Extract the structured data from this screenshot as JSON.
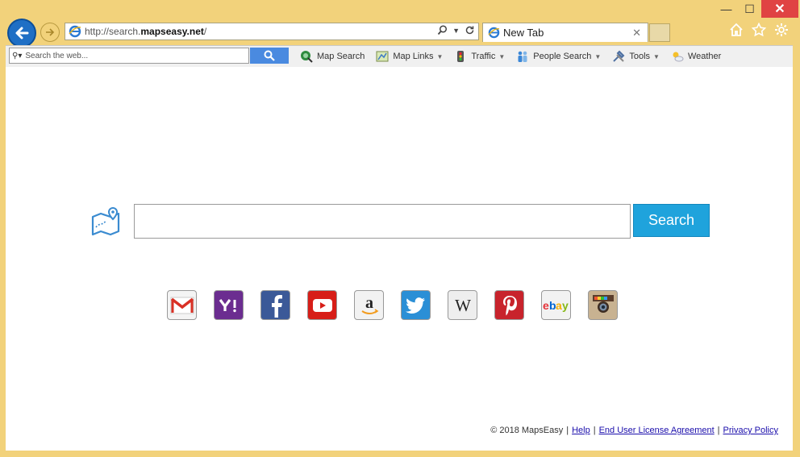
{
  "address_bar": {
    "url_prefix": "http://search.",
    "url_host": "mapseasy.net",
    "url_suffix": "/"
  },
  "tab": {
    "label": "New Tab"
  },
  "toolbar": {
    "search_placeholder": "Search the web...",
    "items": [
      {
        "label": "Map Search",
        "dropdown": false
      },
      {
        "label": "Map Links",
        "dropdown": true
      },
      {
        "label": "Traffic",
        "dropdown": true
      },
      {
        "label": "People Search",
        "dropdown": true
      },
      {
        "label": "Tools",
        "dropdown": true
      },
      {
        "label": "Weather",
        "dropdown": false
      }
    ]
  },
  "main": {
    "search_button": "Search"
  },
  "socials": [
    "gmail-icon",
    "yahoo-icon",
    "facebook-icon",
    "youtube-icon",
    "amazon-icon",
    "twitter-icon",
    "wikipedia-icon",
    "pinterest-icon",
    "ebay-icon",
    "instagram-icon"
  ],
  "footer": {
    "copyright": "© 2018 MapsEasy",
    "links": [
      "Help",
      "End User License Agreement",
      "Privacy Policy"
    ]
  },
  "colors": {
    "chrome": "#f2d27b",
    "search_button": "#1fa3dc",
    "back_button": "#1f6fc5",
    "close_button": "#e04343"
  }
}
